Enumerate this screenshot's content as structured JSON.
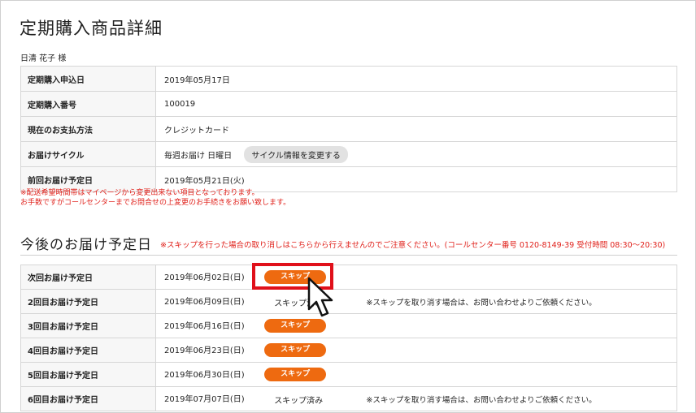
{
  "page": {
    "title": "定期購入商品詳細",
    "customer_name": "日清 花子 様"
  },
  "info": {
    "rows": [
      {
        "label": "定期購入申込日",
        "value": "2019年05月17日"
      },
      {
        "label": "定期購入番号",
        "value": "100019"
      },
      {
        "label": "現在のお支払方法",
        "value": "クレジットカード"
      },
      {
        "label": "お届けサイクル",
        "value": "毎週お届け 日曜日",
        "button": "サイクル情報を変更する"
      },
      {
        "label": "前回お届け予定日",
        "value": "2019年05月21日(火)"
      }
    ],
    "notes": [
      "※配送希望時間帯はマイページから変更出来ない項目となっております。",
      "お手数ですがコールセンターまでお問合せの上変更のお手続きをお願い致します。"
    ]
  },
  "schedule": {
    "title": "今後のお届け予定日",
    "note": "※スキップを行った場合の取り消しはこちらから行えませんのでご注意ください。(コールセンター番号 0120-8149-39 受付時間 08:30～20:30)",
    "skip_label": "スキップ",
    "skipped_label": "スキップ済み",
    "skipped_note": "※スキップを取り消す場合は、お問い合わせよりご依頼ください。",
    "rows": [
      {
        "label": "次回お届け予定日",
        "date": "2019年06月02日(日)",
        "status": "スキップ"
      },
      {
        "label": "2回目お届け予定日",
        "date": "2019年06月09日(日)",
        "status": "スキップ済み",
        "note": "※スキップを取り消す場合は、お問い合わせよりご依頼ください。"
      },
      {
        "label": "3回目お届け予定日",
        "date": "2019年06月16日(日)",
        "status": "スキップ"
      },
      {
        "label": "4回目お届け予定日",
        "date": "2019年06月23日(日)",
        "status": "スキップ"
      },
      {
        "label": "5回目お届け予定日",
        "date": "2019年06月30日(日)",
        "status": "スキップ"
      },
      {
        "label": "6回目お届け予定日",
        "date": "2019年07月07日(日)",
        "status": "スキップ済み",
        "note": "※スキップを取り消す場合は、お問い合わせよりご依頼ください。"
      }
    ]
  },
  "colors": {
    "accent_orange": "#ee6a10",
    "warning_red": "#e0201a",
    "highlight_red": "#e0101a"
  }
}
